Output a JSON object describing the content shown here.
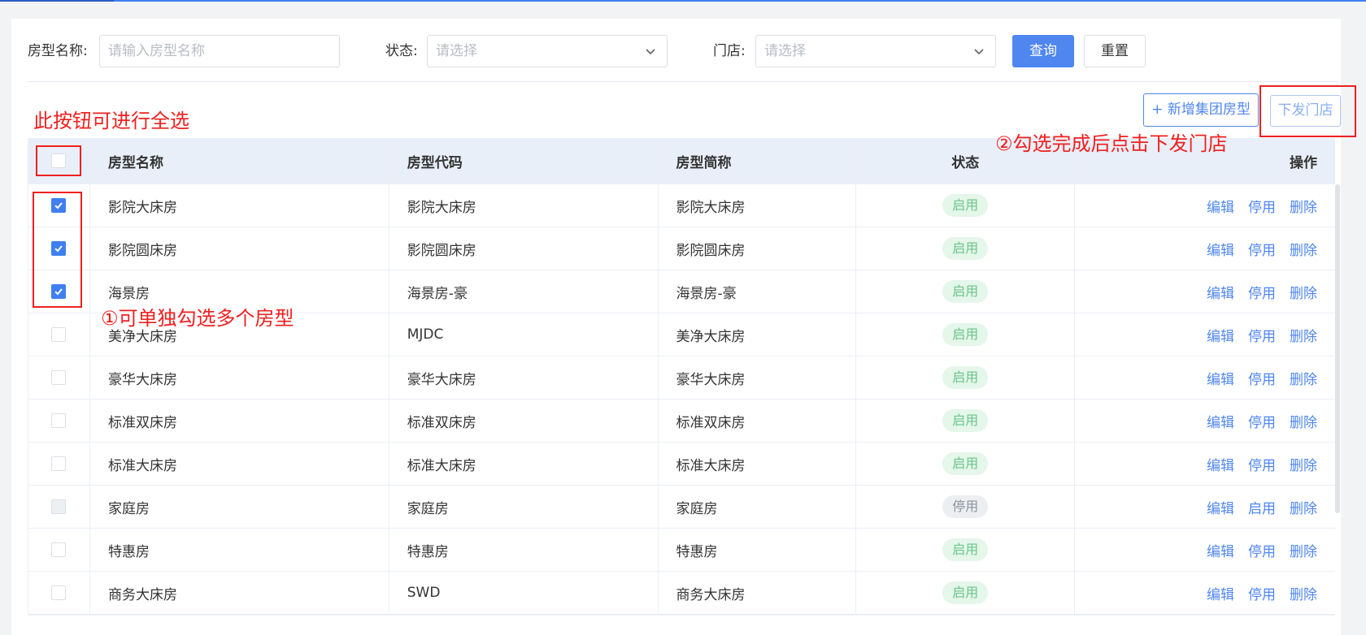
{
  "filters": {
    "name_label": "房型名称:",
    "name_placeholder": "请输入房型名称",
    "status_label": "状态:",
    "status_placeholder": "请选择",
    "store_label": "门店:",
    "store_placeholder": "请选择",
    "query_button": "查询",
    "reset_button": "重置"
  },
  "toolbar": {
    "add_button": "+ 新增集团房型",
    "distribute_button": "下发门店"
  },
  "annotations": {
    "select_all_note": "此按钮可进行全选",
    "multi_select_note": "①可单独勾选多个房型",
    "distribute_note": "②勾选完成后点击下发门店"
  },
  "table": {
    "columns": [
      "房型名称",
      "房型代码",
      "房型简称",
      "状态",
      "操作"
    ],
    "rows": [
      {
        "name": "影院大床房",
        "code": "影院大床房",
        "short": "影院大床房",
        "status": "启用",
        "toggle": "停用",
        "checked": true,
        "disabled": false
      },
      {
        "name": "影院圆床房",
        "code": "影院圆床房",
        "short": "影院圆床房",
        "status": "启用",
        "toggle": "停用",
        "checked": true,
        "disabled": false
      },
      {
        "name": "海景房",
        "code": "海景房-豪",
        "short": "海景房-豪",
        "status": "启用",
        "toggle": "停用",
        "checked": true,
        "disabled": false
      },
      {
        "name": "美净大床房",
        "code": "MJDC",
        "short": "美净大床房",
        "status": "启用",
        "toggle": "停用",
        "checked": false,
        "disabled": false
      },
      {
        "name": "豪华大床房",
        "code": "豪华大床房",
        "short": "豪华大床房",
        "status": "启用",
        "toggle": "停用",
        "checked": false,
        "disabled": false
      },
      {
        "name": "标准双床房",
        "code": "标准双床房",
        "short": "标准双床房",
        "status": "启用",
        "toggle": "停用",
        "checked": false,
        "disabled": false
      },
      {
        "name": "标准大床房",
        "code": "标准大床房",
        "short": "标准大床房",
        "status": "启用",
        "toggle": "停用",
        "checked": false,
        "disabled": false
      },
      {
        "name": "家庭房",
        "code": "家庭房",
        "short": "家庭房",
        "status": "停用",
        "toggle": "启用",
        "checked": false,
        "disabled": true
      },
      {
        "name": "特惠房",
        "code": "特惠房",
        "short": "特惠房",
        "status": "启用",
        "toggle": "停用",
        "checked": false,
        "disabled": false
      },
      {
        "name": "商务大床房",
        "code": "SWD",
        "short": "商务大床房",
        "status": "启用",
        "toggle": "停用",
        "checked": false,
        "disabled": false
      }
    ],
    "edit_label": "编辑",
    "delete_label": "删除"
  },
  "colors": {
    "primary": "#4f86f0",
    "annotation_red": "#f01f1f",
    "enabled_tag": "#69c68a"
  }
}
